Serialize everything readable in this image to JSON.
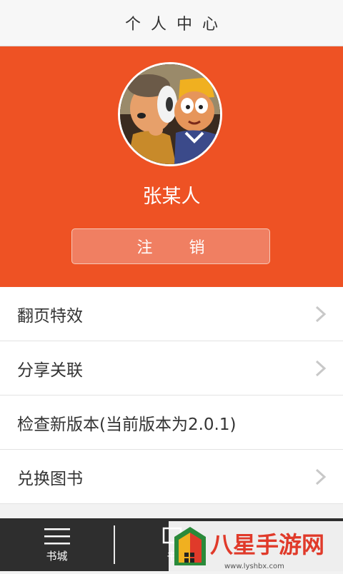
{
  "header": {
    "title": "个人中心"
  },
  "profile": {
    "username": "张某人",
    "logout_label": "注 销",
    "colors": {
      "accent": "#ee5224",
      "button": "#f07f62"
    }
  },
  "menu": {
    "items": [
      {
        "label": "翻页特效",
        "icon": "chevron-right-icon"
      },
      {
        "label": "分享关联",
        "icon": "chevron-right-icon"
      },
      {
        "label": "检查新版本(当前版本为2.0.1)"
      },
      {
        "label": "兑换图书",
        "icon": "chevron-right-icon"
      }
    ]
  },
  "bottom_bar": {
    "tabs": [
      {
        "label": "书城",
        "icon": "menu-lines-icon"
      },
      {
        "label": "书",
        "icon": "bookshelf-icon"
      }
    ]
  },
  "watermark": {
    "title": "八星手游网",
    "url": "www.lyshbx.com"
  }
}
